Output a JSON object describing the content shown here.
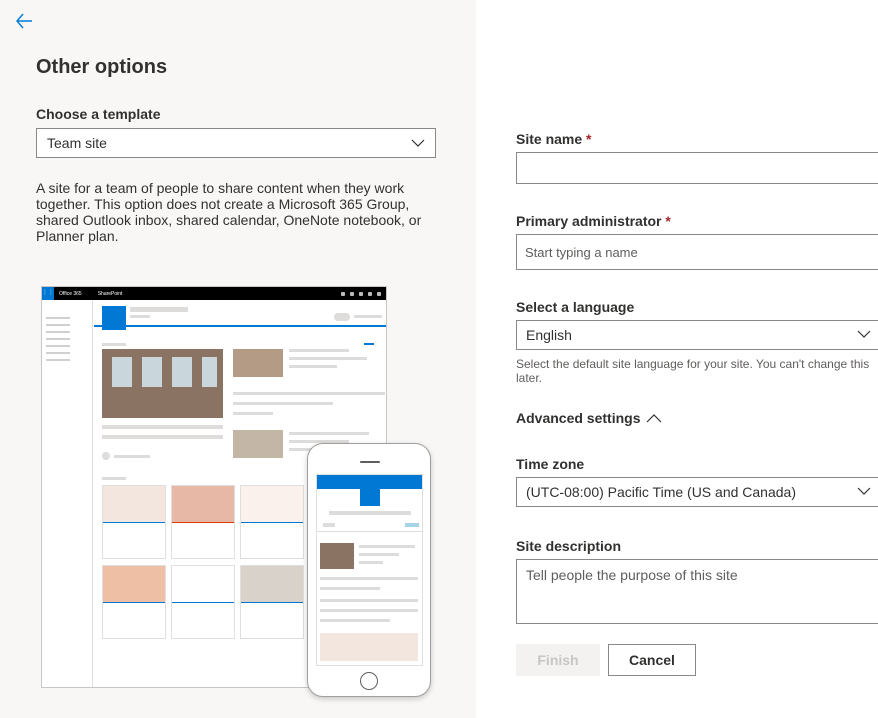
{
  "left_panel": {
    "back_icon": "arrow-left-icon",
    "title": "Other options",
    "template_label": "Choose a template",
    "template_value": "Team site",
    "template_description": "A site for a team of people to share content when they work together. This option does not create a Microsoft 365 Group, shared Outlook inbox, shared calendar, OneNote notebook, or Planner plan.",
    "preview": {
      "app_name": "Office 365",
      "product_name": "SharePoint"
    }
  },
  "form": {
    "site_name_label": "Site name",
    "site_name_value": "",
    "primary_admin_label": "Primary administrator",
    "primary_admin_placeholder": "Start typing a name",
    "required_marker": "*",
    "language_label": "Select a language",
    "language_value": "English",
    "language_helper": "Select the default site language for your site. You can't change this later.",
    "advanced_settings_label": "Advanced settings",
    "advanced_icon": "chevron-up-icon",
    "time_zone_label": "Time zone",
    "time_zone_value": "(UTC-08:00) Pacific Time (US and Canada)",
    "site_description_label": "Site description",
    "site_description_placeholder": "Tell people the purpose of this site",
    "finish_label": "Finish",
    "cancel_label": "Cancel"
  },
  "colors": {
    "accent": "#0078d4",
    "required": "#a4262c",
    "left_panel_bg": "#f8f7f6",
    "text": "#323130",
    "disabled_bg": "#f3f2f1",
    "disabled_text": "#c8c6c4"
  }
}
